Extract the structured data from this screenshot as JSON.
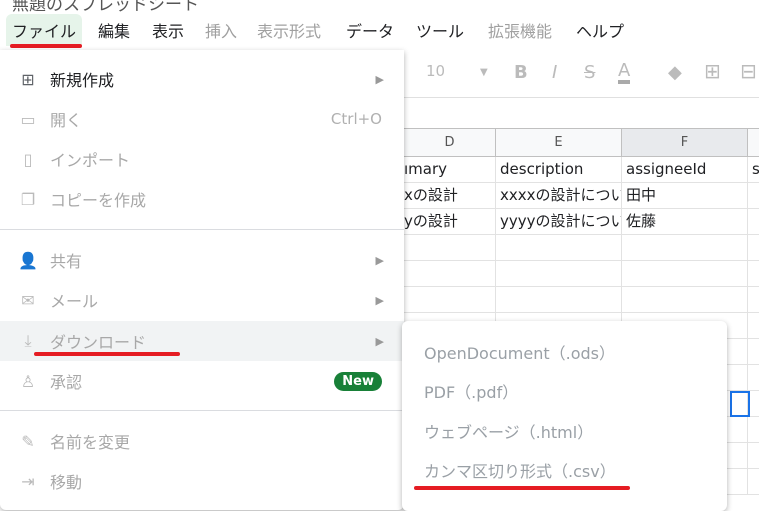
{
  "title": "無題のスプレッドシート",
  "menubar": [
    {
      "label": "ファイル",
      "enabled": true
    },
    {
      "label": "編集",
      "enabled": true
    },
    {
      "label": "表示",
      "enabled": true
    },
    {
      "label": "挿入",
      "enabled": false
    },
    {
      "label": "表示形式",
      "enabled": false
    },
    {
      "label": "データ",
      "enabled": true
    },
    {
      "label": "ツール",
      "enabled": true
    },
    {
      "label": "拡張機能",
      "enabled": false
    },
    {
      "label": "ヘルプ",
      "enabled": true
    }
  ],
  "toolbar": {
    "font_size": "10"
  },
  "sheet": {
    "columns": [
      "D",
      "E",
      "F"
    ],
    "rows": [
      [
        "ımary",
        "description",
        "assigneeId",
        "s"
      ],
      [
        "xの設計",
        "xxxxの設計につい",
        "田中",
        ""
      ],
      [
        "yの設計",
        "yyyyの設計につい",
        "佐藤",
        ""
      ]
    ]
  },
  "file_menu": {
    "items": [
      {
        "label": "新規作成",
        "icon": "plus-box-icon"
      },
      {
        "label": "開く",
        "icon": "folder-icon",
        "shortcut": "Ctrl+O"
      },
      {
        "label": "インポート",
        "icon": "file-icon"
      },
      {
        "label": "コピーを作成",
        "icon": "copy-icon"
      },
      {
        "label": "共有",
        "icon": "person-add-icon"
      },
      {
        "label": "メール",
        "icon": "mail-icon"
      },
      {
        "label": "ダウンロード",
        "icon": "download-icon"
      },
      {
        "label": "承認",
        "icon": "stamp-icon",
        "badge": "New"
      },
      {
        "label": "名前を変更",
        "icon": "pencil-icon"
      },
      {
        "label": "移動",
        "icon": "folder-move-icon"
      }
    ]
  },
  "download_menu": {
    "items": [
      "OpenDocument（.ods）",
      "PDF（.pdf）",
      "ウェブページ（.html）",
      "カンマ区切り形式（.csv）"
    ]
  },
  "colors": {
    "highlight_red": "#e51c23",
    "new_badge": "#188038",
    "selection": "#1a73e8"
  }
}
